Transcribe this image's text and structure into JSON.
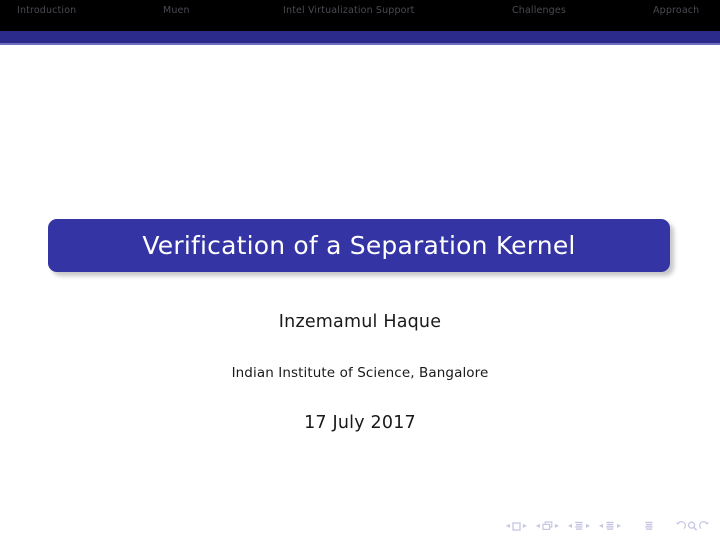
{
  "document": {
    "type": "beamer-presentation-title-slide",
    "page_background": "#ffffff"
  },
  "header": {
    "background_color": "#000000",
    "rule_color": "#2b2b8c",
    "rule_highlight_color": "#6f6fbd",
    "text_color": "#4a4a52",
    "sections": [
      {
        "label": "Introduction"
      },
      {
        "label": "Muen"
      },
      {
        "label": "Intel Virtualization Support"
      },
      {
        "label": "Challenges"
      },
      {
        "label": "Approach"
      }
    ]
  },
  "titlepage": {
    "title": "Verification of a Separation Kernel",
    "title_box_color": "#3434a5",
    "title_text_color": "#ffffff",
    "author": "Inzemamul Haque",
    "institute": "Indian Institute of Science, Bangalore",
    "date": "17 July 2017"
  },
  "navigation_symbols": {
    "color": "#c6c6e4",
    "groups": [
      {
        "name": "slide",
        "prev_label": "◂",
        "icon": "square-icon",
        "next_label": "▸"
      },
      {
        "name": "frame",
        "prev_label": "◂",
        "icon": "frames-icon",
        "next_label": "▸"
      },
      {
        "name": "subsection",
        "prev_label": "◂",
        "icon": "subsection-icon",
        "next_label": "▸"
      },
      {
        "name": "section",
        "prev_label": "◂",
        "icon": "section-icon",
        "next_label": "▸"
      }
    ],
    "presentation": {
      "name": "presentation",
      "icon": "presentation-icon"
    },
    "tail": [
      {
        "name": "back",
        "icon": "back-arrow-icon"
      },
      {
        "name": "search",
        "icon": "search-icon"
      },
      {
        "name": "forward",
        "icon": "forward-arrow-icon"
      }
    ]
  }
}
